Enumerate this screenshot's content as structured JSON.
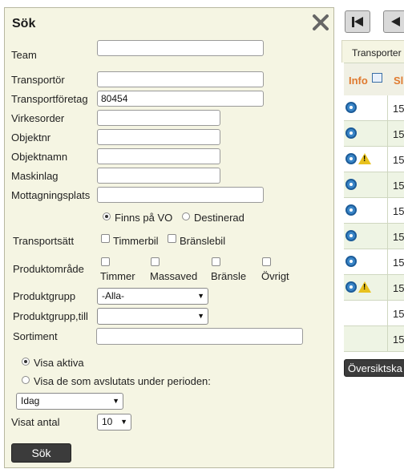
{
  "panel": {
    "title": "Sök",
    "close_icon": "close-icon"
  },
  "fields": {
    "team_label": "Team",
    "team_value": "",
    "transportor_label": "Transportör",
    "transportor_value": "",
    "transportforetag_label": "Transportföretag",
    "transportforetag_value": "80454",
    "virkesorder_label": "Virkesorder",
    "virkesorder_value": "",
    "objektnr_label": "Objektnr",
    "objektnr_value": "",
    "objektnamn_label": "Objektnamn",
    "objektnamn_value": "",
    "maskinlag_label": "Maskinlag",
    "maskinlag_value": "",
    "mottagningsplats_label": "Mottagningsplats",
    "mottagningsplats_value": ""
  },
  "origin": {
    "option1": "Finns på VO",
    "option2": "Destinerad",
    "selected": "Finns på VO"
  },
  "transportsatt": {
    "label": "Transportsätt",
    "option1": "Timmerbil",
    "option2": "Bränslebil"
  },
  "produktomrade": {
    "label": "Produktområde",
    "options": [
      "Timmer",
      "Massaved",
      "Bränsle",
      "Övrigt"
    ]
  },
  "produktgrupp": {
    "label": "Produktgrupp",
    "value": "-Alla-"
  },
  "produktgrupp_till": {
    "label": "Produktgrupp,till",
    "value": ""
  },
  "sortiment": {
    "label": "Sortiment",
    "value": ""
  },
  "visa": {
    "active_label": "Visa aktiva",
    "closed_label": "Visa de som avslutats under perioden:",
    "selected": "Visa aktiva",
    "period_value": "Idag"
  },
  "visat_antal": {
    "label": "Visat antal",
    "value": "10"
  },
  "search_button": "Sök",
  "background_grid": {
    "tab_label": "Transporter",
    "col_info": "Info",
    "col_next": "Sl",
    "row_values": [
      "15",
      "15",
      "15",
      "15",
      "15",
      "15",
      "15",
      "15",
      "15",
      "15"
    ],
    "row_icons": [
      [
        "gear-icon"
      ],
      [
        "gear-icon"
      ],
      [
        "gear-icon",
        "warning-icon"
      ],
      [
        "gear-icon"
      ],
      [
        "gear-icon"
      ],
      [
        "gear-icon"
      ],
      [
        "gear-icon"
      ],
      [
        "gear-icon",
        "warning-icon"
      ],
      [],
      []
    ],
    "overview_button": "Översiktska",
    "colors": {
      "header_text": "#e07a2f",
      "row_alt": "#eef4e4",
      "accent": "#3a86c8"
    }
  }
}
